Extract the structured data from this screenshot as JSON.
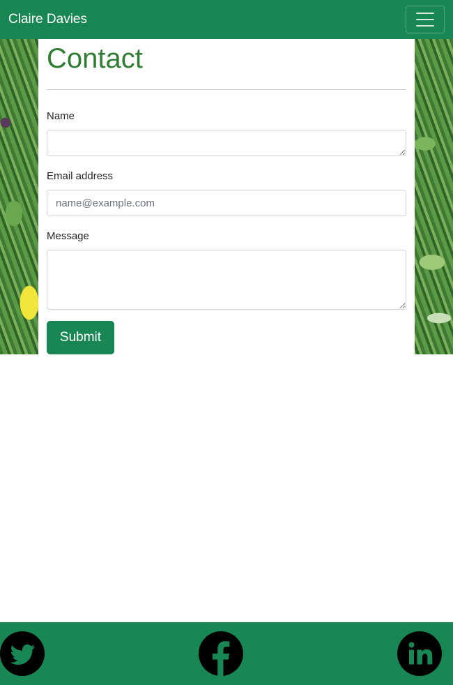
{
  "navbar": {
    "brand": "Claire Davies",
    "toggle_icon": "hamburger-menu-icon"
  },
  "contact": {
    "title": "Contact",
    "name_label": "Name",
    "name_value": "",
    "email_label": "Email address",
    "email_value": "",
    "email_placeholder": "name@example.com",
    "message_label": "Message",
    "message_value": "",
    "submit_label": "Submit"
  },
  "footer": {
    "social_icons": [
      "twitter-icon",
      "facebook-icon",
      "linkedin-icon"
    ]
  },
  "colors": {
    "brand_green": "#198754",
    "title_green": "#2e7d32",
    "icon_color": "#000000",
    "text": "#212529"
  }
}
